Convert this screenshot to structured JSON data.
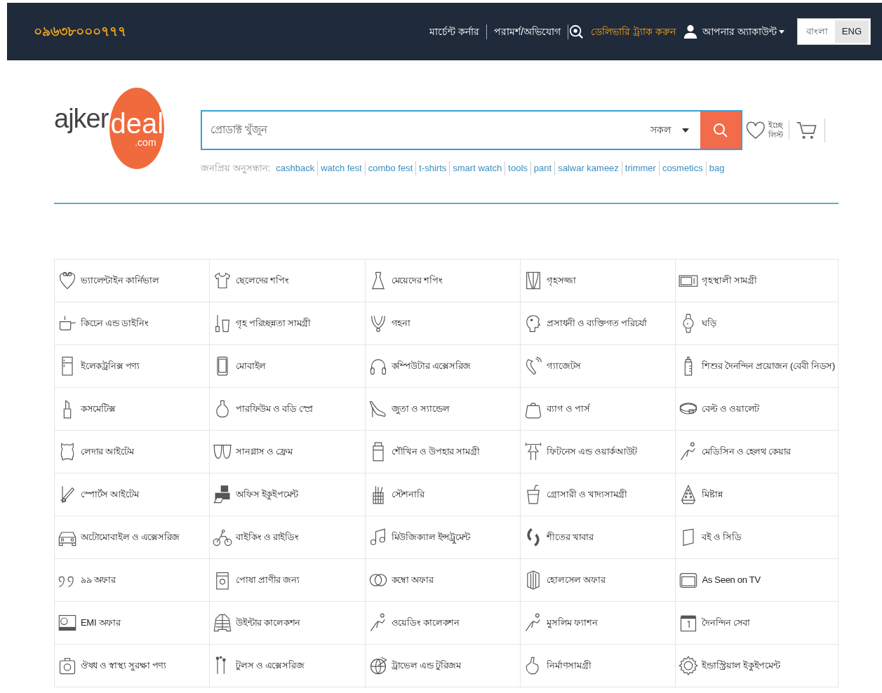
{
  "top_bar": {
    "phone": "০৯৬৩৮০০০৭৭৭",
    "links": [
      {
        "label": "মার্চেন্ট কর্নার",
        "kind": "link"
      },
      {
        "label": "পরামর্শ/অভিযোগ",
        "kind": "link"
      },
      {
        "label": "ডেলিভারি ট্র্যাক করুন",
        "kind": "track"
      },
      {
        "label": "আপনার অ্যাকাউন্ট",
        "kind": "account"
      }
    ],
    "languages": [
      {
        "label": "বাংলা",
        "selected": false
      },
      {
        "label": "ENG",
        "selected": true
      }
    ]
  },
  "logo": {
    "word": "ajker",
    "accent": "deal",
    "suffix": ".com"
  },
  "search": {
    "placeholder": "প্রোডাক্ট খুঁজুন",
    "category": "সকল"
  },
  "wishlist": [
    "ইচ্ছে",
    "লিস্ট"
  ],
  "popular_searches": {
    "label": "জনপ্রিয় অনুসন্ধান:",
    "terms": [
      "cashback",
      "watch fest",
      "combo fest",
      "t-shirts",
      "smart watch",
      "tools",
      "pant",
      "salwar kameez",
      "trimmer",
      "cosmetics",
      "bag"
    ]
  },
  "categories": [
    "ভ্যালেন্টাইন কার্নিভাল",
    "ছেলেদের শপিং",
    "মেয়েদের শপিং",
    "গৃহসজ্জা",
    "গৃহস্থালী সামগ্রী",
    "কিচেন এন্ড ডাইনিং",
    "গৃহ পরিচ্ছন্নতা সামগ্রী",
    "গহনা",
    "প্রসাধনী ও ব্যক্তিগত পরিচর্যা",
    "ঘড়ি",
    "ইলেকট্রনিক্স পণ্য",
    "মোবাইল",
    "কম্পিউটার এক্সেসরিজ",
    "গ্যাজেটস",
    "শিশুর দৈনন্দিন প্রয়োজন (বেবী নিডস)",
    "কসমেটিক্স",
    "পারফিউম ও বডি স্প্রে",
    "জুতা ও স্যান্ডেল",
    "ব্যাগ ও পার্স",
    "বেল্ট ও ওয়ালেট",
    "লেদার আইটেম",
    "সানগ্লাস ও ফ্রেম",
    "শৌখিন ও উপহার সামগ্রী",
    "ফিটনেস এন্ড ওয়ার্কআউট",
    "মেডিসিন ও হেলথ কেয়ার",
    "স্পোর্টস আইটেম",
    "অফিস ইকুইপমেন্ট",
    "স্টেশনারি",
    "গ্রোসারী ও খাদ্যসামগ্রী",
    "মিষ্টান্ন",
    "অটোমোবাইল ও এক্সেসরিজ",
    "বাইকিং ও রাইডিং",
    "মিউজিক্যাল ইন্সট্রুমেন্ট",
    "শীতের খাবার",
    "বই ও সিডি",
    "৯৯ অফার",
    "পোষা প্রাণীর জন্য",
    "কম্বো অফার",
    "হোলসেল অফার",
    "As Seen on TV",
    "EMI অফার",
    "উইন্টার কালেকশন",
    "ওয়েডিং কালেকশন",
    "মুসলিম ফ্যাশন",
    "দৈনন্দিন সেবা",
    "ঔষধ ও স্বাস্থ্য সুরক্ষা পণ্য",
    "টুলস ও এক্সেসরিজ",
    "ট্রাভেল এন্ড টুরিজম",
    "নির্মাণসামগ্রী",
    "ইন্ডাস্ট্রিয়াল ইকুইপমেন্ট"
  ]
}
